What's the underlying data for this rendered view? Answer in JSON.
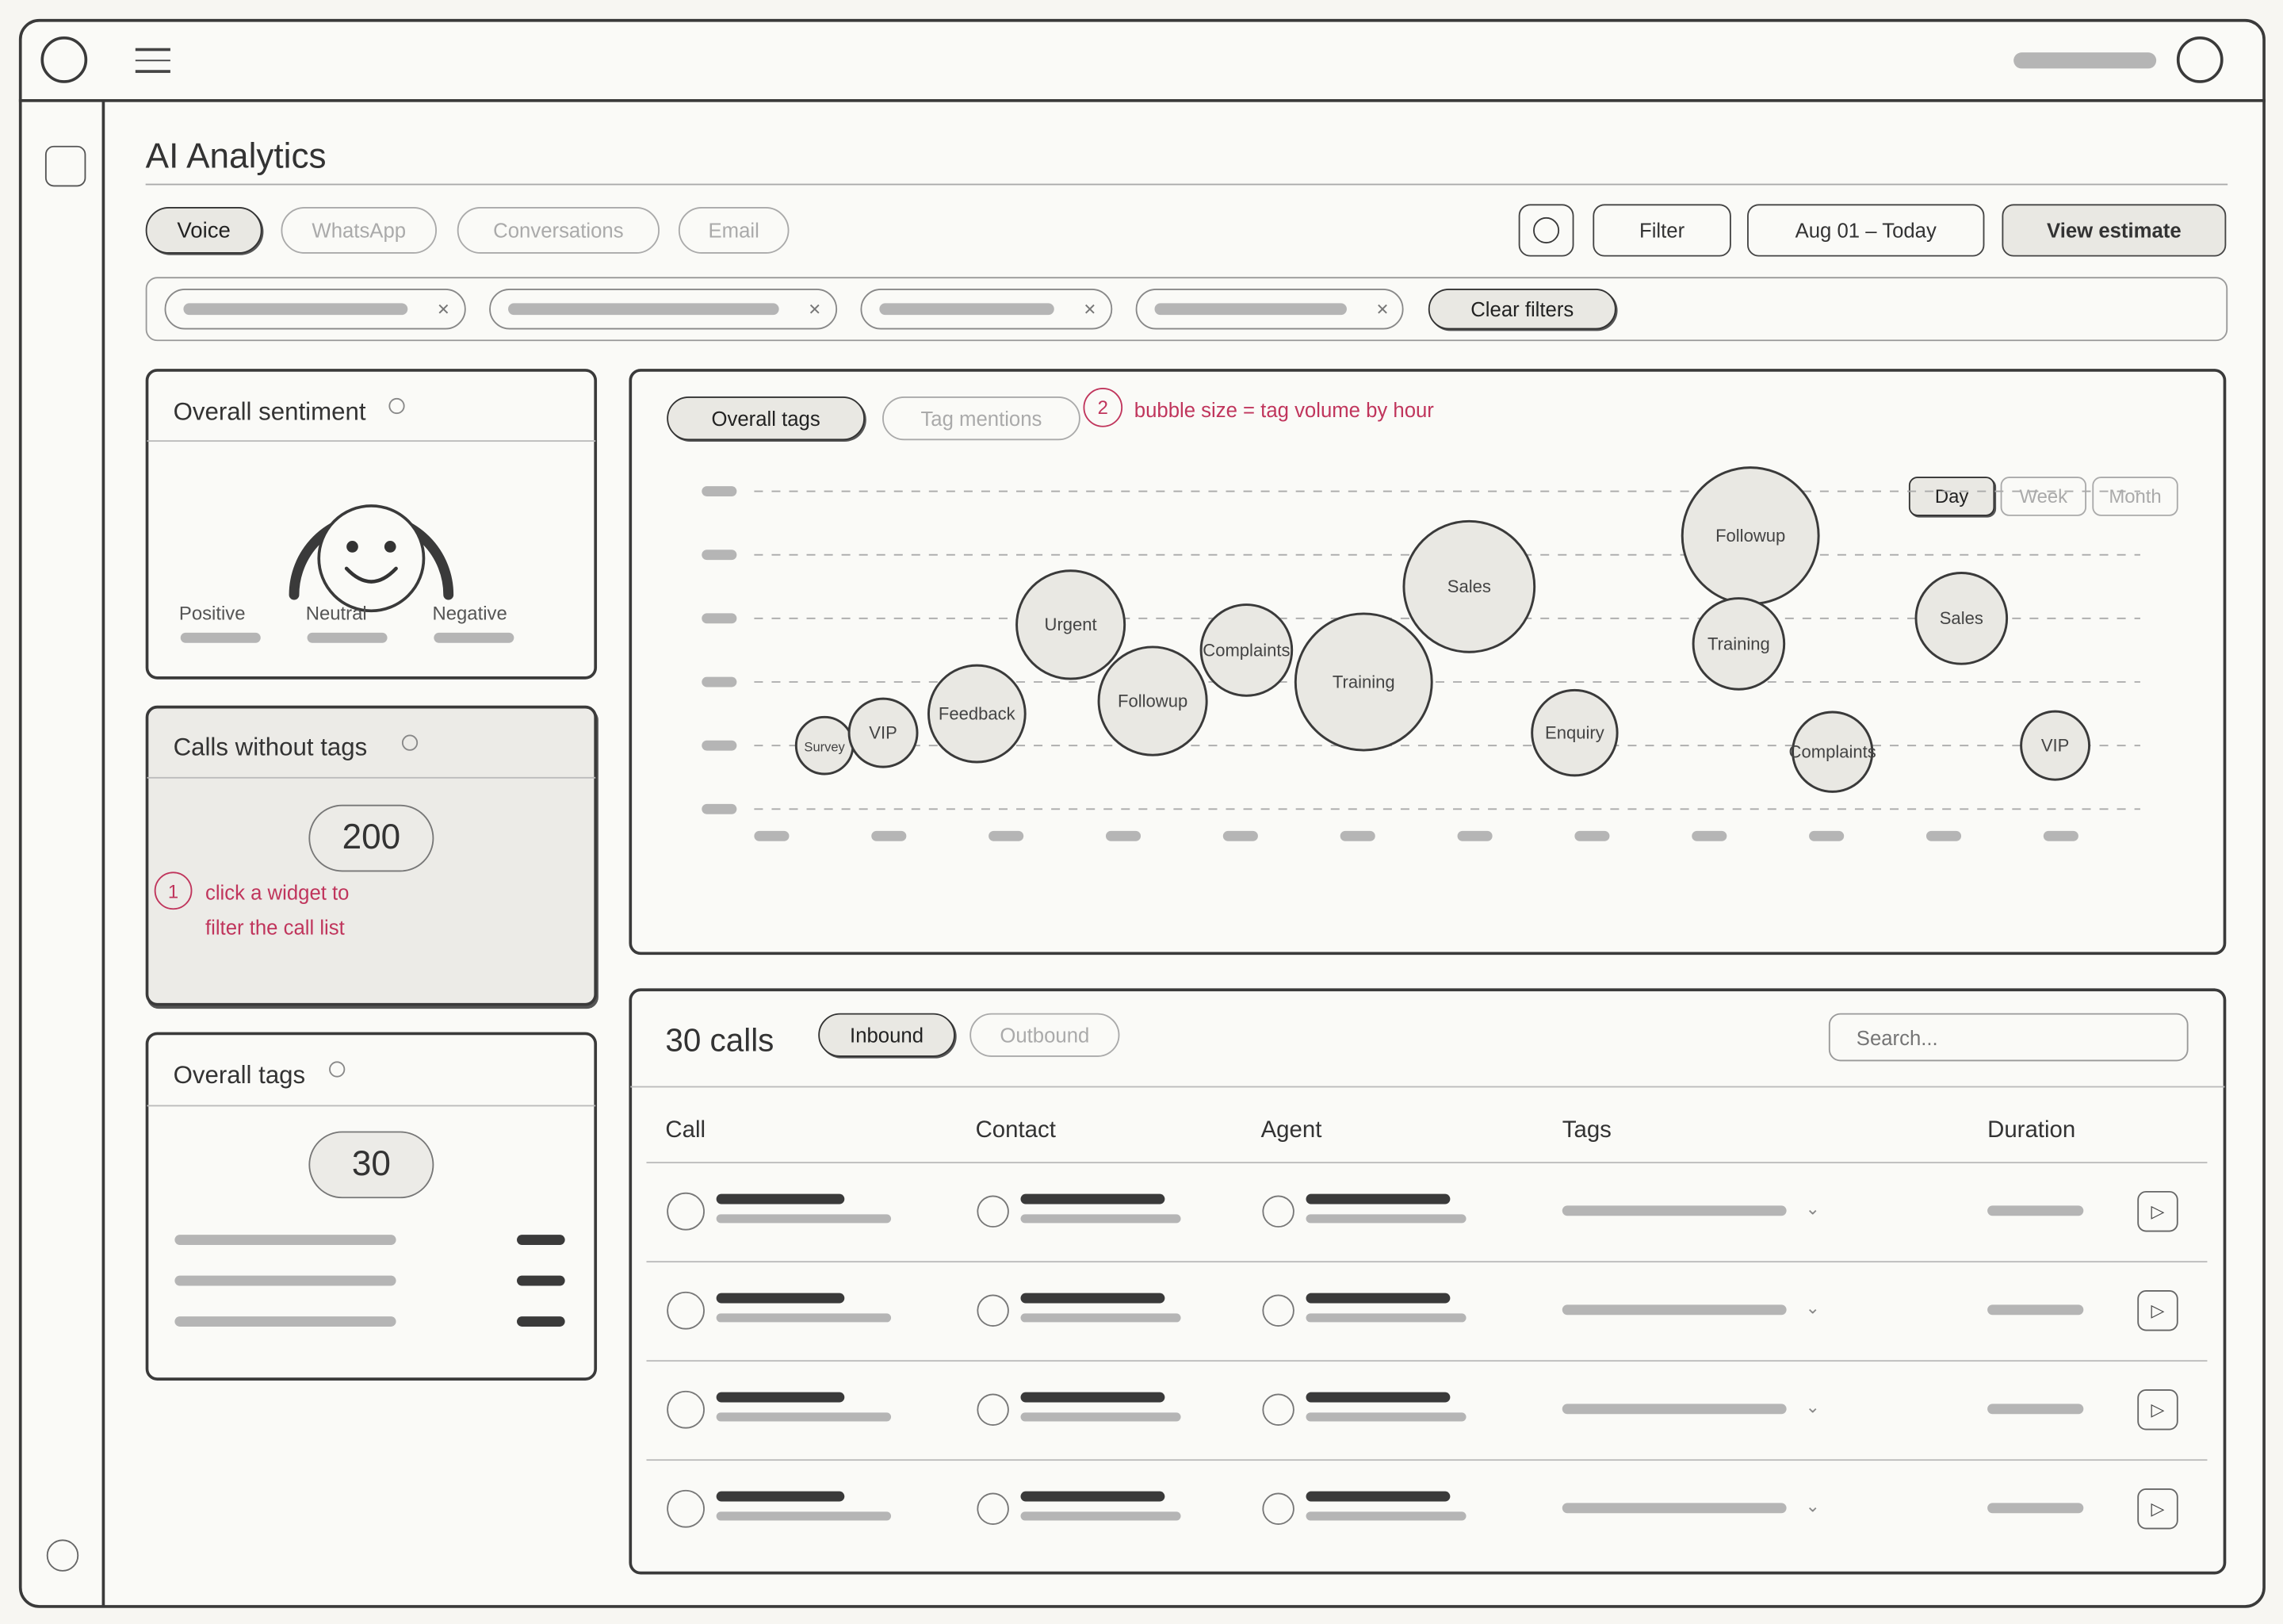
{
  "page": {
    "title": "AI Analytics"
  },
  "channel_tabs": [
    {
      "label": "Voice",
      "active": true
    },
    {
      "label": "WhatsApp",
      "active": false
    },
    {
      "label": "Conversations",
      "active": false
    },
    {
      "label": "Email",
      "active": false
    }
  ],
  "toolbar": {
    "filter_label": "Filter",
    "date_range": "Aug 01 – Today",
    "view_estimate_label": "View estimate"
  },
  "filters": {
    "clear_label": "Clear filters"
  },
  "sentiment": {
    "title": "Overall sentiment",
    "labels": {
      "positive": "Positive",
      "neutral": "Neutral",
      "negative": "Negative"
    }
  },
  "calls_without_tags": {
    "title": "Calls without tags",
    "count": "200",
    "annotation_number": "1",
    "annotation_line1": "click a widget to",
    "annotation_line2": "filter the call list"
  },
  "overall_tags": {
    "title": "Overall tags",
    "count": "30"
  },
  "bubble_chart": {
    "tabs": [
      {
        "label": "Overall tags",
        "active": true
      },
      {
        "label": "Tag mentions",
        "active": false
      }
    ],
    "annotation_number": "2",
    "annotation": "bubble size = tag volume by hour",
    "granularity": [
      {
        "label": "Day",
        "active": true
      },
      {
        "label": "Week",
        "active": false
      },
      {
        "label": "Month",
        "active": false
      }
    ]
  },
  "chart_data": {
    "type": "scatter",
    "grid": true,
    "legend": "none",
    "x_ticks": 12,
    "y_levels": 6,
    "bubbles": [
      {
        "label": "Survey",
        "x": 0.6,
        "y": 1.0,
        "size": 1.0
      },
      {
        "label": "VIP",
        "x": 1.1,
        "y": 1.2,
        "size": 1.2
      },
      {
        "label": "Feedback",
        "x": 1.9,
        "y": 1.5,
        "size": 1.7
      },
      {
        "label": "Urgent",
        "x": 2.7,
        "y": 2.9,
        "size": 1.9
      },
      {
        "label": "Followup",
        "x": 3.4,
        "y": 1.7,
        "size": 1.9
      },
      {
        "label": "Complaints",
        "x": 4.2,
        "y": 2.5,
        "size": 1.6
      },
      {
        "label": "Training",
        "x": 5.2,
        "y": 2.0,
        "size": 2.4
      },
      {
        "label": "Sales",
        "x": 6.1,
        "y": 3.5,
        "size": 2.3
      },
      {
        "label": "Enquiry",
        "x": 7.0,
        "y": 1.2,
        "size": 1.5
      },
      {
        "label": "Followup",
        "x": 8.5,
        "y": 4.3,
        "size": 2.4
      },
      {
        "label": "Training",
        "x": 8.4,
        "y": 2.6,
        "size": 1.6
      },
      {
        "label": "Complaints",
        "x": 9.2,
        "y": 0.9,
        "size": 1.4
      },
      {
        "label": "Sales",
        "x": 10.3,
        "y": 3.0,
        "size": 1.6
      },
      {
        "label": "VIP",
        "x": 11.1,
        "y": 1.0,
        "size": 1.2
      }
    ]
  },
  "calls": {
    "count_label": "30 calls",
    "tabs": [
      {
        "label": "Inbound",
        "active": true
      },
      {
        "label": "Outbound",
        "active": false
      }
    ],
    "search_placeholder": "Search...",
    "columns": {
      "call": "Call",
      "contact": "Contact",
      "agent": "Agent",
      "tags": "Tags",
      "duration": "Duration"
    },
    "rows": 4
  }
}
